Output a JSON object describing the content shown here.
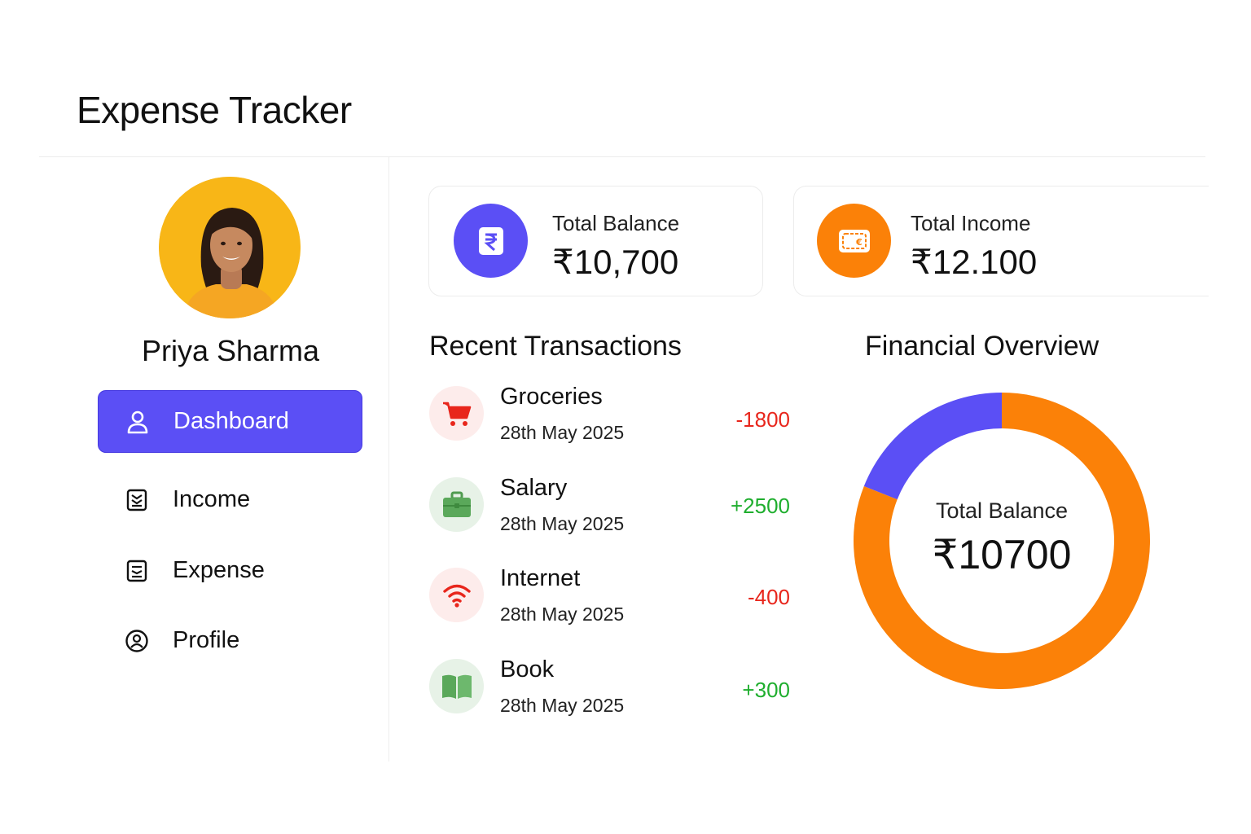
{
  "app": {
    "title": "Expense Tracker"
  },
  "user": {
    "name": "Priya Sharma"
  },
  "nav": {
    "items": [
      {
        "label": "Dashboard",
        "icon": "user-icon",
        "active": true
      },
      {
        "label": "Income",
        "icon": "income-document-icon",
        "active": false
      },
      {
        "label": "Expense",
        "icon": "expense-document-icon",
        "active": false
      },
      {
        "label": "Profile",
        "icon": "profile-circle-icon",
        "active": false
      }
    ]
  },
  "cards": {
    "balance": {
      "label": "Total Balance",
      "value": "₹10,700",
      "icon": "rupee-receipt-icon",
      "color": "#5b4ff5"
    },
    "income": {
      "label": "Total Income",
      "value": "₹12.100",
      "icon": "wallet-icon",
      "color": "#fb8108"
    }
  },
  "transactions": {
    "title": "Recent Transactions",
    "items": [
      {
        "title": "Groceries",
        "date": "28th May 2025",
        "amount": "-1800",
        "type": "expense",
        "icon": "cart-icon"
      },
      {
        "title": "Salary",
        "date": "28th May 2025",
        "amount": "+2500",
        "type": "income",
        "icon": "briefcase-icon"
      },
      {
        "title": "Internet",
        "date": "28th May 2025",
        "amount": "-400",
        "type": "expense",
        "icon": "wifi-icon"
      },
      {
        "title": "Book",
        "date": "28th May 2025",
        "amount": "+300",
        "type": "income",
        "icon": "book-icon"
      }
    ]
  },
  "overview": {
    "title": "Financial Overview",
    "center_label": "Total Balance",
    "center_value": "₹10700"
  },
  "colors": {
    "accent": "#5b4ff5",
    "orange": "#fb8108",
    "expense": "#e8261c",
    "income": "#1fae2e"
  },
  "chart_data": {
    "type": "pie",
    "donut": true,
    "categories": [
      "Purple segment",
      "Orange segment"
    ],
    "values": [
      0.19,
      0.81
    ],
    "colors": [
      "#5b4ff5",
      "#fb8108"
    ]
  }
}
